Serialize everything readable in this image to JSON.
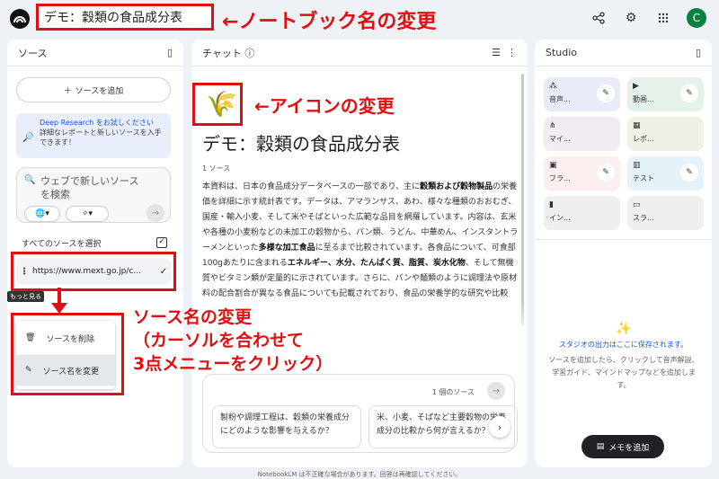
{
  "header": {
    "notebook_title": "デモ：穀類の食品成分表",
    "annotation_title": "←ノートブック名の変更",
    "avatar_letter": "C",
    "icons": [
      "share-icon",
      "gear-icon",
      "apps-grid-icon"
    ]
  },
  "sources": {
    "header": "ソース",
    "add_label": "ソースを追加",
    "deep_research_title": "Deep Research をお試しください",
    "deep_research_desc": "詳細なレポートと新しいソースを入手できます！",
    "web_placeholder": "ウェブで新しいソースを検索",
    "select_all": "すべてのソースを選択",
    "item_url": "https://www.mext.go.jp/c...",
    "tooltip": "もっと見る",
    "menu_delete": "ソースを削除",
    "menu_rename": "ソース名を変更"
  },
  "annotation_source": {
    "line1": "ソース名の変更",
    "line2": "（カーソルを合わせて",
    "line3": "3点メニューをクリック）"
  },
  "chat": {
    "header": "チャット",
    "annotation_icon": "←アイコンの変更",
    "title": "デモ：穀類の食品成分表",
    "source_count": "1 ソース",
    "body_parts": [
      {
        "t": "本資料は、日本の食品成分データベースの一部であり、主に",
        "b": false
      },
      {
        "t": "穀類および穀物製品",
        "b": true
      },
      {
        "t": "の栄養価を詳細に示す統計表です。データは、アマランサス、あわ、様々な種類のおおむぎ、国産・輸入小麦、そして米やそばといった広範な品目を網羅しています。内容は、玄米や各種の小麦粉などの未加工の穀物から、パン類、うどん、中華めん、インスタントラーメンといった",
        "b": false
      },
      {
        "t": "多様な加工食品",
        "b": true
      },
      {
        "t": "に至るまで比較されています。各食品について、可食部100gあたりに含まれる",
        "b": false
      },
      {
        "t": "エネルギー、水分、たんぱく質、脂質、炭水化物",
        "b": true
      },
      {
        "t": "、そして無機質やビタミン類が定量的に示されています。さらに、パンや麺類のように調理法や原材料の配合割合が異なる食品についても記載されており、食品の栄養学的な研究や比較",
        "b": false
      }
    ],
    "input_source_count": "1 個のソース",
    "suggestion1": "製粉や調理工程は、穀類の栄養成分にどのような影響を与えるか？",
    "suggestion2": "米、小麦、そばなど主要穀物の栄養成分の比較から何が言えるか？"
  },
  "studio": {
    "header": "Studio",
    "tiles": [
      {
        "label": "音声...",
        "icon": "waveform-icon",
        "color": "#e9ecf8",
        "pen": true
      },
      {
        "label": "動画...",
        "icon": "video-icon",
        "color": "#e6f2e9",
        "pen": true
      },
      {
        "label": "マイ...",
        "icon": "mindmap-icon",
        "color": "#f1ecf3",
        "pen": false
      },
      {
        "label": "レポ...",
        "icon": "report-icon",
        "color": "#f0f1e6",
        "pen": false
      },
      {
        "label": "フラ...",
        "icon": "flashcard-icon",
        "color": "#fbeeee",
        "pen": true
      },
      {
        "label": "テスト",
        "icon": "quiz-icon",
        "color": "#e5f2f7",
        "pen": true
      },
      {
        "label": "イン...",
        "icon": "infographic-icon",
        "color": "#efefef",
        "pen": false
      },
      {
        "label": "スラ...",
        "icon": "slides-icon",
        "color": "#efefef",
        "pen": false
      }
    ],
    "output_title": "スタジオの出力はここに保存されます。",
    "output_desc": "ソースを追加したら、クリックして音声解説、学習ガイド、マインドマップなどを追加します。",
    "memo_button": "メモを追加"
  },
  "footer": "NotebookLM は不正確な場合があります。回答は再確認してください。"
}
